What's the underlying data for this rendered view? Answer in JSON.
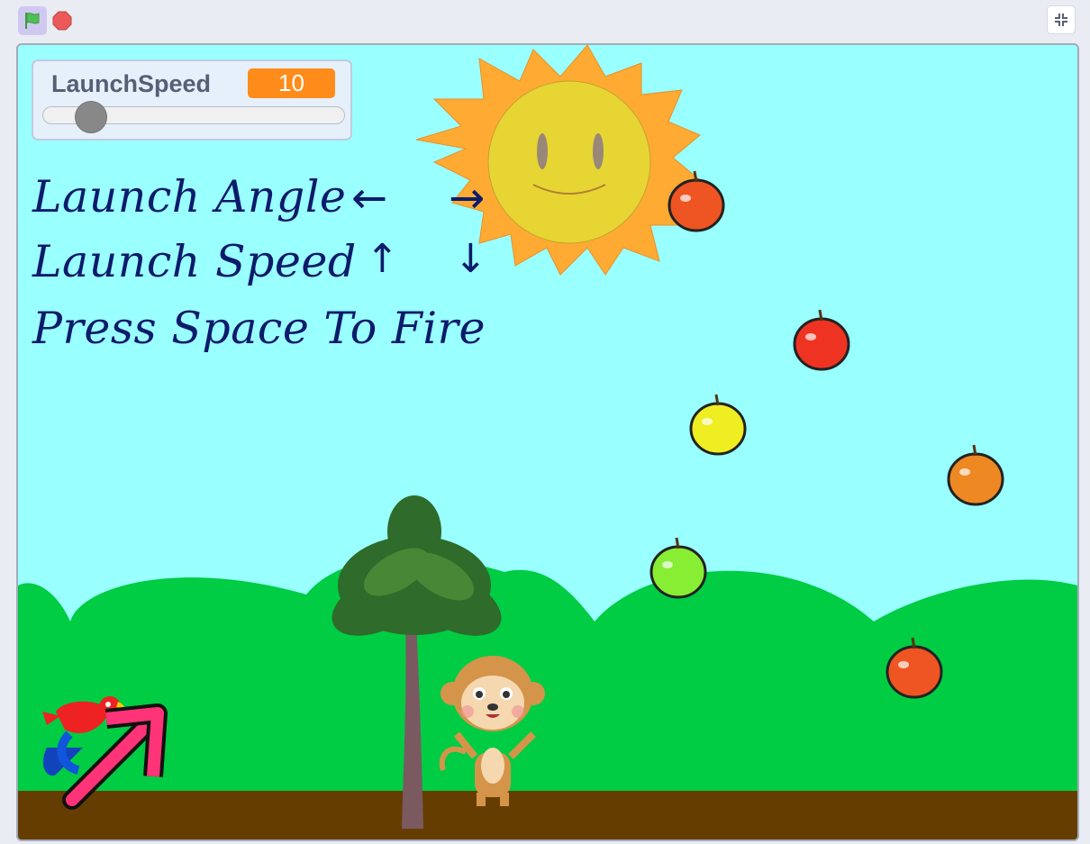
{
  "toolbar": {
    "green_flag_icon": "green-flag-icon",
    "stop_icon": "stop-sign-icon",
    "fullscreen_icon": "exit-fullscreen-icon"
  },
  "monitor": {
    "label": "LaunchSpeed",
    "value": "10",
    "slider_fraction": 0.1
  },
  "instructions": {
    "line1": "Launch Angle",
    "line1_arrows": [
      "←",
      "→"
    ],
    "line2": "Launch Speed",
    "line2_arrows": [
      "↑",
      "↓"
    ],
    "line3": "Press Space To Fire"
  },
  "sprites": [
    "sun",
    "apple-orange-red",
    "apple-red",
    "apple-yellow",
    "apple-orange",
    "apple-green",
    "apple-orange-red-low",
    "palm-tree",
    "monkey",
    "parrot",
    "launch-arrow"
  ],
  "colors": {
    "sky": "#99ffff",
    "hills": "#00cc44",
    "ground": "#663d00",
    "text": "#0d1b6b",
    "accent_orange": "#ff8c1a"
  }
}
